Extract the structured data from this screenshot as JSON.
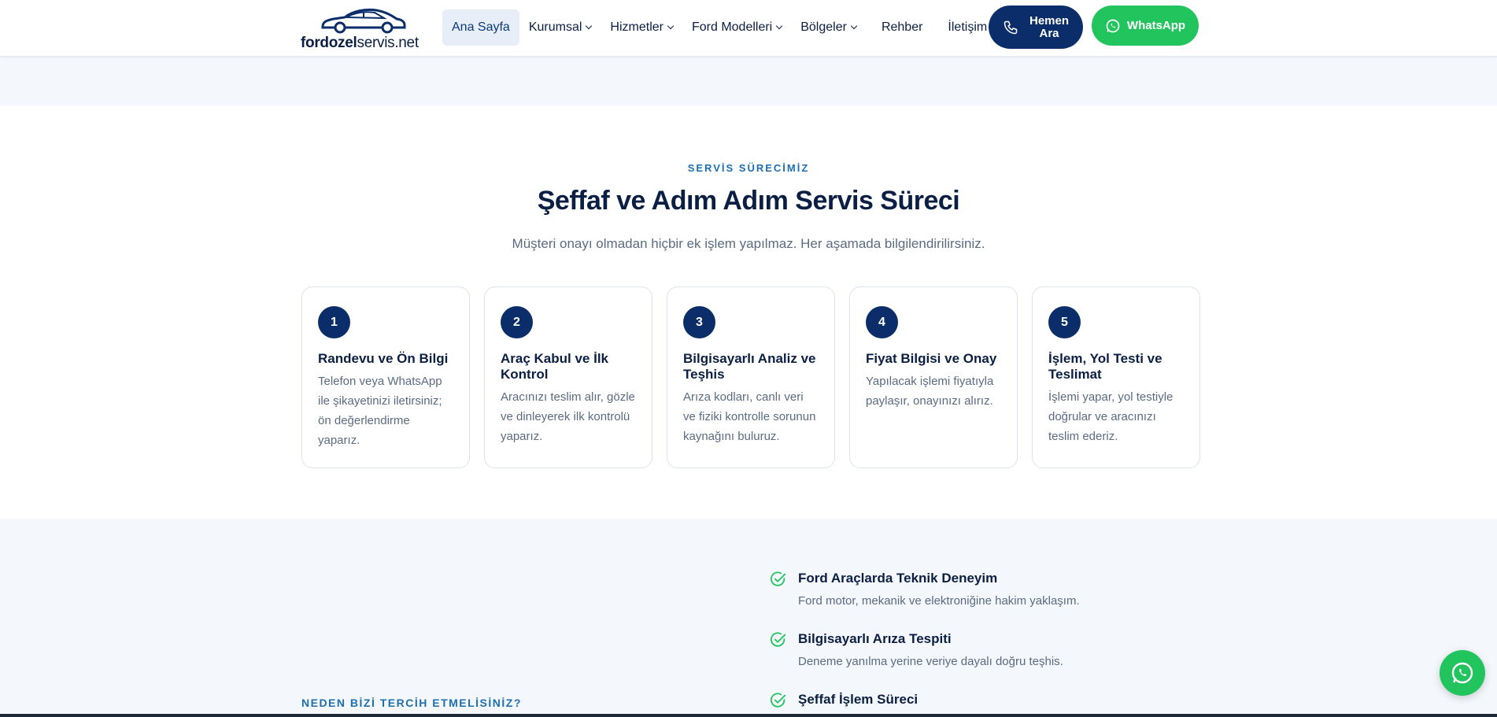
{
  "header": {
    "logo": {
      "bold": "fordozel",
      "thin": "servis.net"
    },
    "nav": [
      {
        "label": "Ana Sayfa",
        "active": true,
        "dropdown": false
      },
      {
        "label": "Kurumsal",
        "active": false,
        "dropdown": true
      },
      {
        "label": "Hizmetler",
        "active": false,
        "dropdown": true
      },
      {
        "label": "Ford Modelleri",
        "active": false,
        "dropdown": true
      },
      {
        "label": "Bölgeler",
        "active": false,
        "dropdown": true
      },
      {
        "label": "Rehber",
        "active": false,
        "dropdown": false
      },
      {
        "label": "İletişim",
        "active": false,
        "dropdown": false
      }
    ],
    "call_button": {
      "line1": "Hemen",
      "line2": "Ara"
    },
    "whatsapp_button": "WhatsApp"
  },
  "process": {
    "eyebrow": "SERVİS SÜRECİMİZ",
    "title": "Şeffaf ve Adım Adım Servis Süreci",
    "subtitle": "Müşteri onayı olmadan hiçbir ek işlem yapılmaz. Her aşamada bilgilendirilirsiniz.",
    "steps": [
      {
        "num": "1",
        "title": "Randevu ve Ön Bilgi",
        "desc": "Telefon veya WhatsApp ile şikayetinizi iletirsiniz; ön değerlendirme yaparız."
      },
      {
        "num": "2",
        "title": "Araç Kabul ve İlk Kontrol",
        "desc": "Aracınızı teslim alır, gözle ve dinleyerek ilk kontrolü yaparız."
      },
      {
        "num": "3",
        "title": "Bilgisayarlı Analiz ve Teşhis",
        "desc": "Arıza kodları, canlı veri ve fiziki kontrolle sorunun kaynağını buluruz."
      },
      {
        "num": "4",
        "title": "Fiyat Bilgisi ve Onay",
        "desc": "Yapılacak işlemi fiyatıyla paylaşır, onayınızı alırız."
      },
      {
        "num": "5",
        "title": "İşlem, Yol Testi ve Teslimat",
        "desc": "İşlemi yapar, yol testiyle doğrular ve aracınızı teslim ederiz."
      }
    ]
  },
  "why": {
    "eyebrow": "NEDEN BİZİ TERCİH ETMELİSİNİZ?",
    "features": [
      {
        "title": "Ford Araçlarda Teknik Deneyim",
        "desc": "Ford motor, mekanik ve elektroniğine hakim yaklaşım."
      },
      {
        "title": "Bilgisayarlı Arıza Tespiti",
        "desc": "Deneme yanılma yerine veriye dayalı doğru teşhis."
      },
      {
        "title": "Şeffaf İşlem Süreci",
        "desc": ""
      }
    ]
  },
  "colors": {
    "navy": "#0b2e6b",
    "accent_blue": "#1e6fb0",
    "whatsapp_green": "#22c45e",
    "muted_text": "#5b6b82"
  }
}
